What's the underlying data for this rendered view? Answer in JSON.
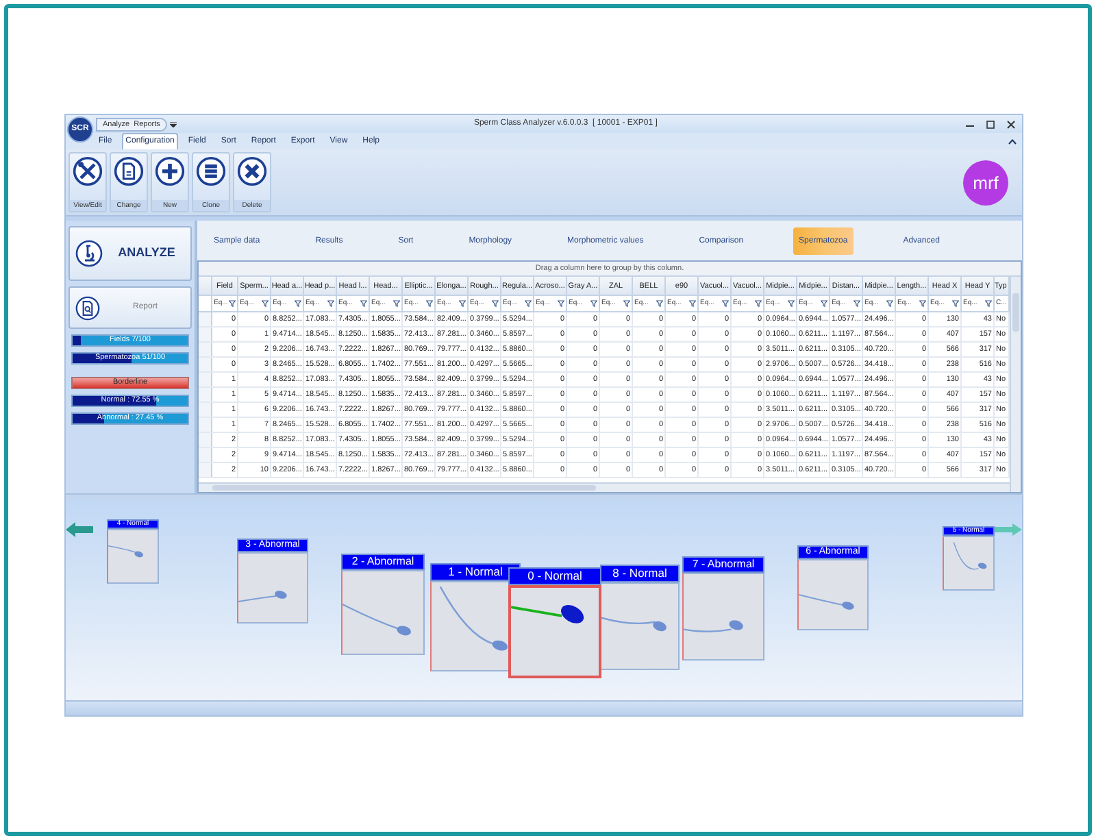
{
  "window": {
    "logo": "SCR",
    "quick_tab": "Analyze  Reports",
    "title": "Sperm Class Analyzer v.6.0.0.3  [ 10001 - EXP01 ]"
  },
  "menu": [
    {
      "label": "File",
      "selected": false
    },
    {
      "label": "Configuration",
      "selected": true
    },
    {
      "label": "Field",
      "selected": false
    },
    {
      "label": "Sort",
      "selected": false
    },
    {
      "label": "Report",
      "selected": false
    },
    {
      "label": "Export",
      "selected": false
    },
    {
      "label": "View",
      "selected": false
    },
    {
      "label": "Help",
      "selected": false
    }
  ],
  "ribbon_buttons": [
    {
      "label": "View/Edit"
    },
    {
      "label": "Change"
    },
    {
      "label": "New"
    },
    {
      "label": "Clone"
    },
    {
      "label": "Delete"
    }
  ],
  "brand_logo": "mrf",
  "side_panel": {
    "analyze": "ANALYZE",
    "report": "Report",
    "bars": [
      {
        "kind": "progress",
        "label": "Fields 7/100",
        "level": 0.07
      },
      {
        "kind": "progress",
        "label": "Spermatozoa 51/100",
        "level": 0.51
      },
      {
        "kind": "flag",
        "label": "Borderline"
      },
      {
        "kind": "progress",
        "label": "Normal : 72.55 %",
        "level": 0.7255
      },
      {
        "kind": "progress",
        "label": "Abnormal : 27.45 %",
        "level": 0.2745
      }
    ]
  },
  "tabs": [
    {
      "label": "Sample data",
      "selected": false
    },
    {
      "label": "Results",
      "selected": false
    },
    {
      "label": "Sort",
      "selected": false
    },
    {
      "label": "Morphology",
      "selected": false
    },
    {
      "label": "Morphometric values",
      "selected": false
    },
    {
      "label": "Comparison",
      "selected": false
    },
    {
      "label": "Spermatozoa",
      "selected": true
    },
    {
      "label": "Advanced",
      "selected": false
    }
  ],
  "grid": {
    "group_hint": "Drag a column here to group by this column.",
    "columns": [
      {
        "header": "Field",
        "filter": "Eq..."
      },
      {
        "header": "Sperm...",
        "filter": "Eq..."
      },
      {
        "header": "Head a...",
        "filter": "Eq..."
      },
      {
        "header": "Head p...",
        "filter": "Eq..."
      },
      {
        "header": "Head l...",
        "filter": "Eq..."
      },
      {
        "header": "Head...",
        "filter": "Eq..."
      },
      {
        "header": "Elliptic...",
        "filter": "Eq..."
      },
      {
        "header": "Elonga...",
        "filter": "Eq..."
      },
      {
        "header": "Rough...",
        "filter": "Eq..."
      },
      {
        "header": "Regula...",
        "filter": "Eq..."
      },
      {
        "header": "Acroso...",
        "filter": "Eq..."
      },
      {
        "header": "Gray A...",
        "filter": "Eq..."
      },
      {
        "header": "ZAL",
        "filter": "Eq..."
      },
      {
        "header": "BELL",
        "filter": "Eq..."
      },
      {
        "header": "e90",
        "filter": "Eq..."
      },
      {
        "header": "Vacuol...",
        "filter": "Eq..."
      },
      {
        "header": "Vacuol...",
        "filter": "Eq..."
      },
      {
        "header": "Midpie...",
        "filter": "Eq..."
      },
      {
        "header": "Midpie...",
        "filter": "Eq..."
      },
      {
        "header": "Distan...",
        "filter": "Eq..."
      },
      {
        "header": "Midpie...",
        "filter": "Eq..."
      },
      {
        "header": "Length...",
        "filter": "Eq..."
      },
      {
        "header": "Head X",
        "filter": "Eq..."
      },
      {
        "header": "Head Y",
        "filter": "Eq..."
      },
      {
        "header": "Typ",
        "filter": "C..."
      }
    ],
    "rows": [
      [
        "0",
        "0",
        "8.8252...",
        "17.083...",
        "7.4305...",
        "1.8055...",
        "73.584...",
        "82.409...",
        "0.3799...",
        "5.5294...",
        "0",
        "0",
        "0",
        "0",
        "0",
        "0",
        "0",
        "0.0964...",
        "0.6944...",
        "1.0577...",
        "24.496...",
        "0",
        "130",
        "43",
        "No"
      ],
      [
        "0",
        "1",
        "9.4714...",
        "18.545...",
        "8.1250...",
        "1.5835...",
        "72.413...",
        "87.281...",
        "0.3460...",
        "5.8597...",
        "0",
        "0",
        "0",
        "0",
        "0",
        "0",
        "0",
        "0.1060...",
        "0.6211...",
        "1.1197...",
        "87.564...",
        "0",
        "407",
        "157",
        "No"
      ],
      [
        "0",
        "2",
        "9.2206...",
        "16.743...",
        "7.2222...",
        "1.8267...",
        "80.769...",
        "79.777...",
        "0.4132...",
        "5.8860...",
        "0",
        "0",
        "0",
        "0",
        "0",
        "0",
        "0",
        "3.5011...",
        "0.6211...",
        "0.3105...",
        "40.720...",
        "0",
        "566",
        "317",
        "No"
      ],
      [
        "0",
        "3",
        "8.2465...",
        "15.528...",
        "6.8055...",
        "1.7402...",
        "77.551...",
        "81.200...",
        "0.4297...",
        "5.5665...",
        "0",
        "0",
        "0",
        "0",
        "0",
        "0",
        "0",
        "2.9706...",
        "0.5007...",
        "0.5726...",
        "34.418...",
        "0",
        "238",
        "516",
        "No"
      ],
      [
        "1",
        "4",
        "8.8252...",
        "17.083...",
        "7.4305...",
        "1.8055...",
        "73.584...",
        "82.409...",
        "0.3799...",
        "5.5294...",
        "0",
        "0",
        "0",
        "0",
        "0",
        "0",
        "0",
        "0.0964...",
        "0.6944...",
        "1.0577...",
        "24.496...",
        "0",
        "130",
        "43",
        "No"
      ],
      [
        "1",
        "5",
        "9.4714...",
        "18.545...",
        "8.1250...",
        "1.5835...",
        "72.413...",
        "87.281...",
        "0.3460...",
        "5.8597...",
        "0",
        "0",
        "0",
        "0",
        "0",
        "0",
        "0",
        "0.1060...",
        "0.6211...",
        "1.1197...",
        "87.564...",
        "0",
        "407",
        "157",
        "No"
      ],
      [
        "1",
        "6",
        "9.2206...",
        "16.743...",
        "7.2222...",
        "1.8267...",
        "80.769...",
        "79.777...",
        "0.4132...",
        "5.8860...",
        "0",
        "0",
        "0",
        "0",
        "0",
        "0",
        "0",
        "3.5011...",
        "0.6211...",
        "0.3105...",
        "40.720...",
        "0",
        "566",
        "317",
        "No"
      ],
      [
        "1",
        "7",
        "8.2465...",
        "15.528...",
        "6.8055...",
        "1.7402...",
        "77.551...",
        "81.200...",
        "0.4297...",
        "5.5665...",
        "0",
        "0",
        "0",
        "0",
        "0",
        "0",
        "0",
        "2.9706...",
        "0.5007...",
        "0.5726...",
        "34.418...",
        "0",
        "238",
        "516",
        "No"
      ],
      [
        "2",
        "8",
        "8.8252...",
        "17.083...",
        "7.4305...",
        "1.8055...",
        "73.584...",
        "82.409...",
        "0.3799...",
        "5.5294...",
        "0",
        "0",
        "0",
        "0",
        "0",
        "0",
        "0",
        "0.0964...",
        "0.6944...",
        "1.0577...",
        "24.496...",
        "0",
        "130",
        "43",
        "No"
      ],
      [
        "2",
        "9",
        "9.4714...",
        "18.545...",
        "8.1250...",
        "1.5835...",
        "72.413...",
        "87.281...",
        "0.3460...",
        "5.8597...",
        "0",
        "0",
        "0",
        "0",
        "0",
        "0",
        "0",
        "0.1060...",
        "0.6211...",
        "1.1197...",
        "87.564...",
        "0",
        "407",
        "157",
        "No"
      ],
      [
        "2",
        "10",
        "9.2206...",
        "16.743...",
        "7.2222...",
        "1.8267...",
        "80.769...",
        "79.777...",
        "0.4132...",
        "5.8860...",
        "0",
        "0",
        "0",
        "0",
        "0",
        "0",
        "0",
        "3.5011...",
        "0.6211...",
        "0.3105...",
        "40.720...",
        "0",
        "566",
        "317",
        "No"
      ]
    ]
  },
  "carousel": [
    {
      "label": "4 - Normal",
      "selected": false
    },
    {
      "label": "3 - Abnormal",
      "selected": false
    },
    {
      "label": "2 - Abnormal",
      "selected": false
    },
    {
      "label": "1 - Normal",
      "selected": false
    },
    {
      "label": "0 - Normal",
      "selected": true
    },
    {
      "label": "8 - Normal",
      "selected": false
    },
    {
      "label": "7 - Abnormal",
      "selected": false
    },
    {
      "label": "6 - Abnormal",
      "selected": false
    },
    {
      "label": "5 - Normal",
      "selected": false
    }
  ]
}
